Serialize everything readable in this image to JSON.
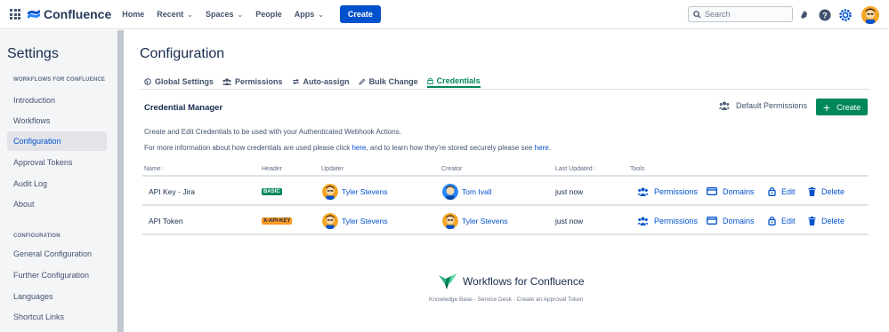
{
  "topnav": {
    "app_name": "Confluence",
    "links": [
      "Home",
      "Recent",
      "Spaces",
      "People",
      "Apps"
    ],
    "create_label": "Create",
    "search_placeholder": "Search"
  },
  "sidebar": {
    "title": "Settings",
    "section1": "WORKFLOWS FOR CONFLUENCE",
    "items1": [
      "Introduction",
      "Workflows",
      "Configuration",
      "Approval Tokens",
      "Audit Log",
      "About"
    ],
    "section2": "CONFIGURATION",
    "items2": [
      "General Configuration",
      "Further Configuration",
      "Languages",
      "Shortcut Links"
    ]
  },
  "main": {
    "title": "Configuration",
    "tabs": [
      "Global Settings",
      "Permissions",
      "Auto-assign",
      "Bulk Change",
      "Credentials"
    ],
    "active_tab": "Credentials",
    "section_title": "Credential Manager",
    "default_permissions": "Default Permissions",
    "create_label": "Create",
    "desc1": "Create and Edit Credentials to be used with your Authenticated Webhook Actions.",
    "desc2_pre": "For more information about how credentials are used please click ",
    "desc2_link1": "here",
    "desc2_mid": ", and to learn how they're stored securely please see ",
    "desc2_link2": "here",
    "desc2_post": ".",
    "columns": [
      "Name",
      "Header",
      "Updater",
      "Creator",
      "Last Updated",
      "Tools"
    ],
    "rows": [
      {
        "name": "API Key - Jira",
        "header": "BASIC",
        "header_color": "#00875a",
        "updater": "Tyler Stevens",
        "creator": "Tom Ivall",
        "last_updated": "just now"
      },
      {
        "name": "API Token",
        "header": "X-API-KEY",
        "header_color": "#ff991f",
        "updater": "Tyler Stevens",
        "creator": "Tyler Stevens",
        "last_updated": "just now"
      }
    ],
    "tools": [
      "Permissions",
      "Domains",
      "Edit",
      "Delete"
    ]
  },
  "footer": {
    "brand": "Workflows for Confluence",
    "links": "Knowledge Base - Service Desk - Create an Approval Token"
  },
  "colors": {
    "accent": "#0052cc",
    "success": "#00875a"
  }
}
